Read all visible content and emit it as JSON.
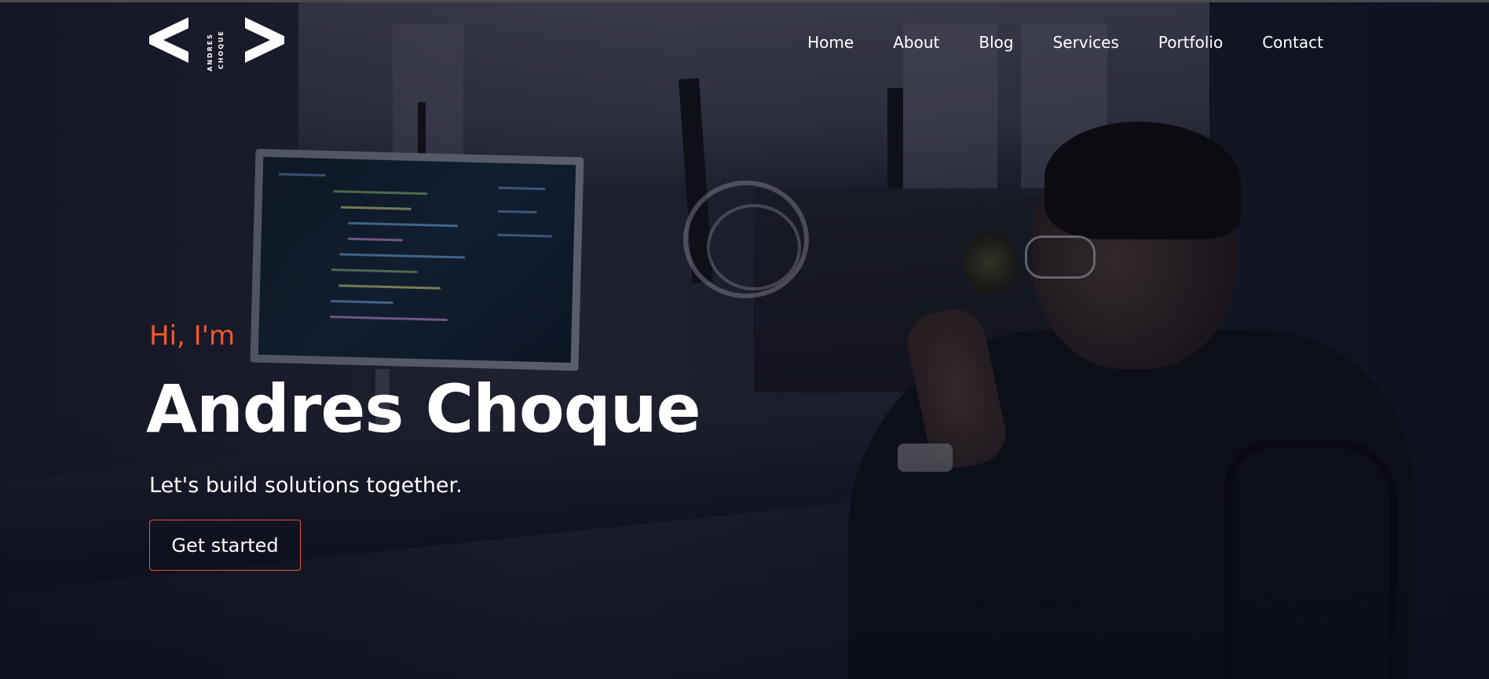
{
  "brand": {
    "logo_line1": "ANDRES",
    "logo_line2": "CHOQUE",
    "icon": "code-brackets-icon"
  },
  "nav": {
    "items": [
      {
        "label": "Home"
      },
      {
        "label": "About"
      },
      {
        "label": "Blog"
      },
      {
        "label": "Services"
      },
      {
        "label": "Portfolio"
      },
      {
        "label": "Contact"
      }
    ]
  },
  "hero": {
    "greeting": "Hi, I'm",
    "name": "Andres Choque",
    "tagline": "Let's build solutions together.",
    "cta_label": "Get started"
  },
  "colors": {
    "accent": "#f0592b",
    "text": "#ffffff",
    "background": "#1a1c2c"
  }
}
